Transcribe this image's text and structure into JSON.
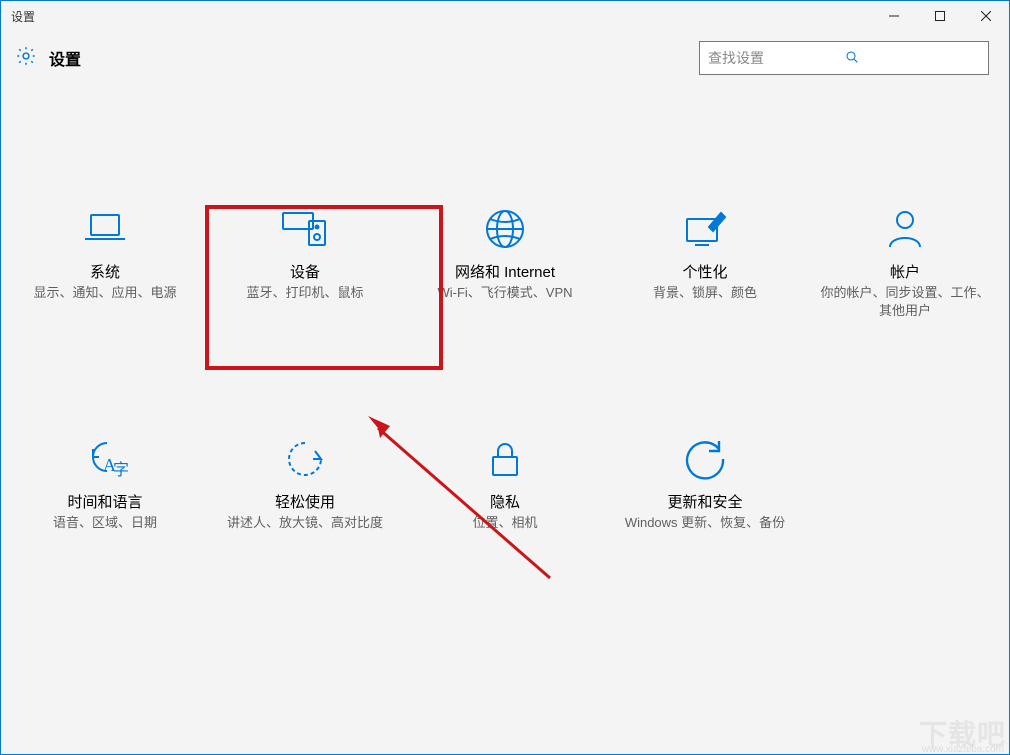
{
  "window": {
    "title": "设置"
  },
  "header": {
    "app_title": "设置",
    "search_placeholder": "查找设置"
  },
  "tiles": [
    {
      "title": "系统",
      "desc": "显示、通知、应用、电源"
    },
    {
      "title": "设备",
      "desc": "蓝牙、打印机、鼠标"
    },
    {
      "title": "网络和 Internet",
      "desc": "Wi-Fi、飞行模式、VPN"
    },
    {
      "title": "个性化",
      "desc": "背景、锁屏、颜色"
    },
    {
      "title": "帐户",
      "desc": "你的帐户、同步设置、工作、其他用户"
    },
    {
      "title": "时间和语言",
      "desc": "语音、区域、日期"
    },
    {
      "title": "轻松使用",
      "desc": "讲述人、放大镜、高对比度"
    },
    {
      "title": "隐私",
      "desc": "位置、相机"
    },
    {
      "title": "更新和安全",
      "desc": "Windows 更新、恢复、备份"
    }
  ],
  "annotation": {
    "highlighted_tile_index": 1
  },
  "watermark": {
    "main": "下载吧",
    "sub": "www.xiazaiba.com"
  },
  "colors": {
    "accent": "#0078d7",
    "highlight": "#cc1518"
  }
}
